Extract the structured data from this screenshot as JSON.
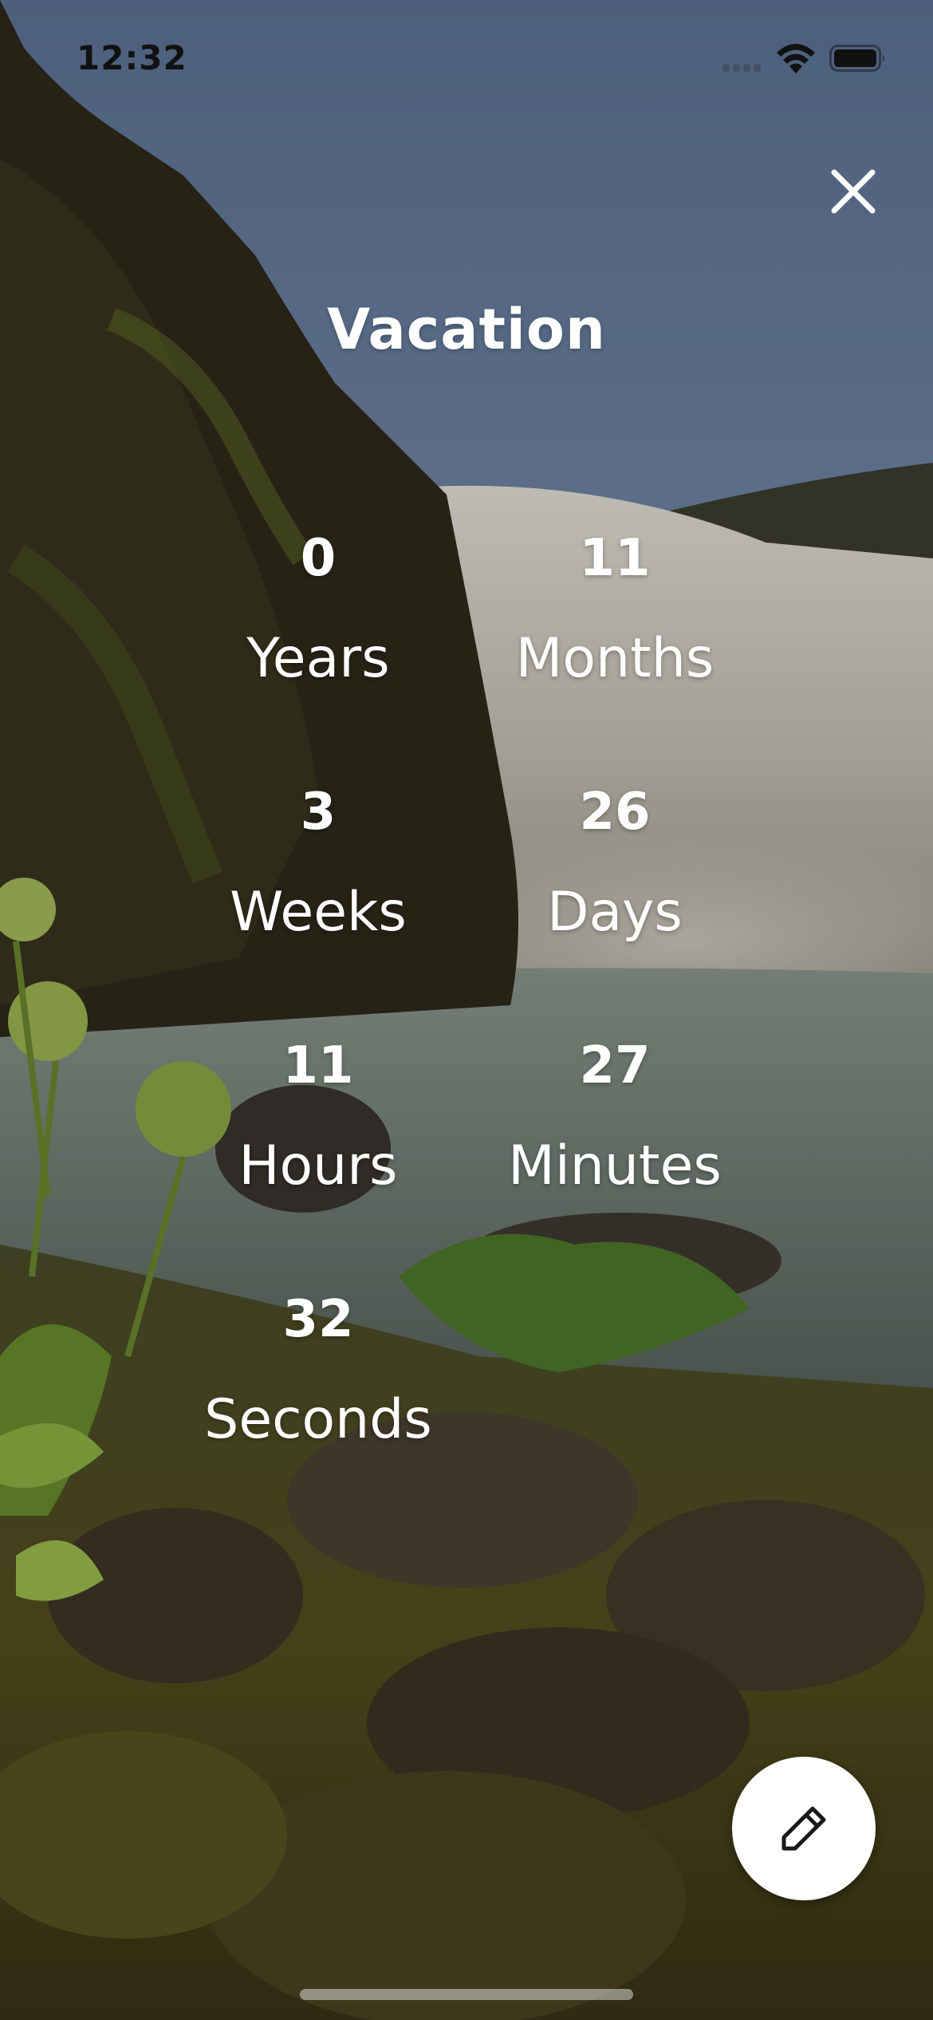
{
  "status_bar": {
    "time": "12:32",
    "icons": [
      "cellular-signal-icon",
      "wifi-icon",
      "battery-icon"
    ]
  },
  "header": {
    "close_icon": "close-icon"
  },
  "countdown": {
    "title": "Vacation",
    "units": [
      {
        "value": "0",
        "label": "Years"
      },
      {
        "value": "11",
        "label": "Months"
      },
      {
        "value": "3",
        "label": "Weeks"
      },
      {
        "value": "26",
        "label": "Days"
      },
      {
        "value": "11",
        "label": "Hours"
      },
      {
        "value": "27",
        "label": "Minutes"
      },
      {
        "value": "32",
        "label": "Seconds"
      }
    ]
  },
  "actions": {
    "edit_icon": "pencil-icon"
  },
  "colors": {
    "text": "#ffffff",
    "fab_background": "#ffffff",
    "fab_icon": "#1a1a1a",
    "sky": "#6f85a8",
    "moss": "#4a5a1c"
  }
}
